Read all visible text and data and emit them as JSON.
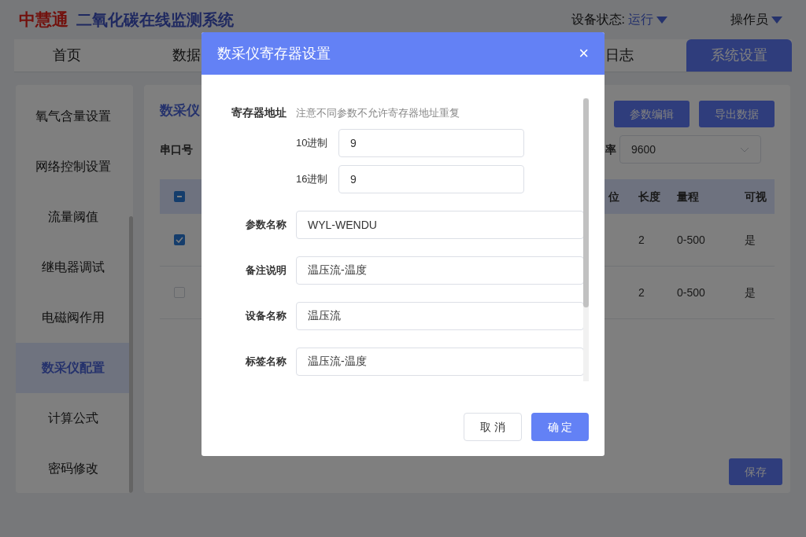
{
  "header": {
    "logo": "中慧通",
    "system_title": "二氧化碳在线监测系统",
    "status_label": "设备状态:",
    "status_value": "运行",
    "user": "操作员"
  },
  "tabs": [
    {
      "label": "首页",
      "selected": false
    },
    {
      "label": "数据",
      "selected": false
    },
    {
      "label": "日志",
      "selected": false
    },
    {
      "label": "系统设置",
      "selected": true
    }
  ],
  "sidebar": {
    "items": [
      {
        "label": "氧气含量设置",
        "selected": false
      },
      {
        "label": "网络控制设置",
        "selected": false
      },
      {
        "label": "流量阈值",
        "selected": false
      },
      {
        "label": "继电器调试",
        "selected": false
      },
      {
        "label": "电磁阀作用",
        "selected": false
      },
      {
        "label": "数采仪配置",
        "selected": true
      },
      {
        "label": "计算公式",
        "selected": false
      },
      {
        "label": "密码修改",
        "selected": false
      }
    ]
  },
  "content": {
    "title": "数采仪",
    "buttons": [
      "参数编辑",
      "导出数据"
    ],
    "port_label": "串口号",
    "baud_label": "率",
    "baud_value": "9600",
    "table": {
      "header_checkbox": {
        "indeterminate": true
      },
      "partial_column_label": "位",
      "columns": [
        "长度",
        "量程",
        "可视"
      ],
      "rows": [
        {
          "checked": true,
          "cells": [
            "2",
            "0-500",
            "是"
          ]
        },
        {
          "checked": false,
          "cells": [
            "2",
            "0-500",
            "是"
          ]
        }
      ]
    },
    "save_button": "保存"
  },
  "dialog": {
    "title": "数采仪寄存器设置",
    "close": "×",
    "address_label": "寄存器地址",
    "address_hint": "注意不同参数不允许寄存器地址重复",
    "address_fields": [
      {
        "label": "10进制",
        "value": "9"
      },
      {
        "label": "16进制",
        "value": "9"
      }
    ],
    "fields": [
      {
        "label": "参数名称",
        "value": "WYL-WENDU"
      },
      {
        "label": "备注说明",
        "value": "温压流-温度"
      },
      {
        "label": "设备名称",
        "value": "温压流"
      },
      {
        "label": "标签名称",
        "value": "温压流-温度"
      }
    ],
    "cancel": "取 消",
    "confirm": "确 定"
  }
}
